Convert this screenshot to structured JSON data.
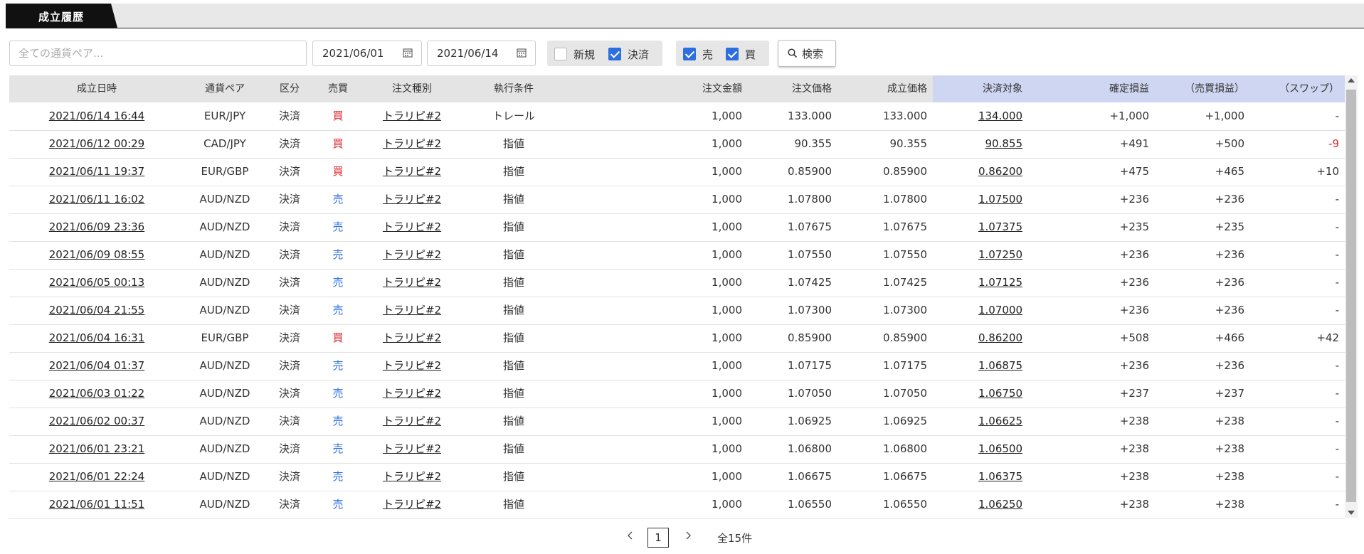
{
  "tab": {
    "label": "成立履歴"
  },
  "filters": {
    "search_placeholder": "全ての通貨ペア...",
    "date_from": "2021/06/01",
    "date_to": "2021/06/14",
    "kubun": [
      {
        "label": "新規",
        "checked": false
      },
      {
        "label": "決済",
        "checked": true
      }
    ],
    "baibai": [
      {
        "label": "売",
        "checked": true
      },
      {
        "label": "買",
        "checked": true
      }
    ],
    "search_button": "検索"
  },
  "columns": [
    "成立日時",
    "通貨ペア",
    "区分",
    "売買",
    "注文種別",
    "執行条件",
    "注文金額",
    "注文価格",
    "成立価格",
    "決済対象",
    "確定損益",
    "（売買損益）",
    "（スワップ）"
  ],
  "rows": [
    {
      "datetime": "2021/06/14 16:44",
      "pair": "EUR/JPY",
      "kubun": "決済",
      "side": "買",
      "order_type": "トラリピ#2",
      "condition": "トレール",
      "amount": "1,000",
      "order_price": "133.000",
      "fill_price": "133.000",
      "target": "134.000",
      "pnl": "+1,000",
      "trade_pnl": "+1,000",
      "swap": "-"
    },
    {
      "datetime": "2021/06/12 00:29",
      "pair": "CAD/JPY",
      "kubun": "決済",
      "side": "買",
      "order_type": "トラリピ#2",
      "condition": "指値",
      "amount": "1,000",
      "order_price": "90.355",
      "fill_price": "90.355",
      "target": "90.855",
      "pnl": "+491",
      "trade_pnl": "+500",
      "swap": "-9"
    },
    {
      "datetime": "2021/06/11 19:37",
      "pair": "EUR/GBP",
      "kubun": "決済",
      "side": "買",
      "order_type": "トラリピ#2",
      "condition": "指値",
      "amount": "1,000",
      "order_price": "0.85900",
      "fill_price": "0.85900",
      "target": "0.86200",
      "pnl": "+475",
      "trade_pnl": "+465",
      "swap": "+10"
    },
    {
      "datetime": "2021/06/11 16:02",
      "pair": "AUD/NZD",
      "kubun": "決済",
      "side": "売",
      "order_type": "トラリピ#2",
      "condition": "指値",
      "amount": "1,000",
      "order_price": "1.07800",
      "fill_price": "1.07800",
      "target": "1.07500",
      "pnl": "+236",
      "trade_pnl": "+236",
      "swap": "-"
    },
    {
      "datetime": "2021/06/09 23:36",
      "pair": "AUD/NZD",
      "kubun": "決済",
      "side": "売",
      "order_type": "トラリピ#2",
      "condition": "指値",
      "amount": "1,000",
      "order_price": "1.07675",
      "fill_price": "1.07675",
      "target": "1.07375",
      "pnl": "+235",
      "trade_pnl": "+235",
      "swap": "-"
    },
    {
      "datetime": "2021/06/09 08:55",
      "pair": "AUD/NZD",
      "kubun": "決済",
      "side": "売",
      "order_type": "トラリピ#2",
      "condition": "指値",
      "amount": "1,000",
      "order_price": "1.07550",
      "fill_price": "1.07550",
      "target": "1.07250",
      "pnl": "+236",
      "trade_pnl": "+236",
      "swap": "-"
    },
    {
      "datetime": "2021/06/05 00:13",
      "pair": "AUD/NZD",
      "kubun": "決済",
      "side": "売",
      "order_type": "トラリピ#2",
      "condition": "指値",
      "amount": "1,000",
      "order_price": "1.07425",
      "fill_price": "1.07425",
      "target": "1.07125",
      "pnl": "+236",
      "trade_pnl": "+236",
      "swap": "-"
    },
    {
      "datetime": "2021/06/04 21:55",
      "pair": "AUD/NZD",
      "kubun": "決済",
      "side": "売",
      "order_type": "トラリピ#2",
      "condition": "指値",
      "amount": "1,000",
      "order_price": "1.07300",
      "fill_price": "1.07300",
      "target": "1.07000",
      "pnl": "+236",
      "trade_pnl": "+236",
      "swap": "-"
    },
    {
      "datetime": "2021/06/04 16:31",
      "pair": "EUR/GBP",
      "kubun": "決済",
      "side": "買",
      "order_type": "トラリピ#2",
      "condition": "指値",
      "amount": "1,000",
      "order_price": "0.85900",
      "fill_price": "0.85900",
      "target": "0.86200",
      "pnl": "+508",
      "trade_pnl": "+466",
      "swap": "+42"
    },
    {
      "datetime": "2021/06/04 01:37",
      "pair": "AUD/NZD",
      "kubun": "決済",
      "side": "売",
      "order_type": "トラリピ#2",
      "condition": "指値",
      "amount": "1,000",
      "order_price": "1.07175",
      "fill_price": "1.07175",
      "target": "1.06875",
      "pnl": "+236",
      "trade_pnl": "+236",
      "swap": "-"
    },
    {
      "datetime": "2021/06/03 01:22",
      "pair": "AUD/NZD",
      "kubun": "決済",
      "side": "売",
      "order_type": "トラリピ#2",
      "condition": "指値",
      "amount": "1,000",
      "order_price": "1.07050",
      "fill_price": "1.07050",
      "target": "1.06750",
      "pnl": "+237",
      "trade_pnl": "+237",
      "swap": "-"
    },
    {
      "datetime": "2021/06/02 00:37",
      "pair": "AUD/NZD",
      "kubun": "決済",
      "side": "売",
      "order_type": "トラリピ#2",
      "condition": "指値",
      "amount": "1,000",
      "order_price": "1.06925",
      "fill_price": "1.06925",
      "target": "1.06625",
      "pnl": "+238",
      "trade_pnl": "+238",
      "swap": "-"
    },
    {
      "datetime": "2021/06/01 23:21",
      "pair": "AUD/NZD",
      "kubun": "決済",
      "side": "売",
      "order_type": "トラリピ#2",
      "condition": "指値",
      "amount": "1,000",
      "order_price": "1.06800",
      "fill_price": "1.06800",
      "target": "1.06500",
      "pnl": "+238",
      "trade_pnl": "+238",
      "swap": "-"
    },
    {
      "datetime": "2021/06/01 22:24",
      "pair": "AUD/NZD",
      "kubun": "決済",
      "side": "売",
      "order_type": "トラリピ#2",
      "condition": "指値",
      "amount": "1,000",
      "order_price": "1.06675",
      "fill_price": "1.06675",
      "target": "1.06375",
      "pnl": "+238",
      "trade_pnl": "+238",
      "swap": "-"
    },
    {
      "datetime": "2021/06/01 11:51",
      "pair": "AUD/NZD",
      "kubun": "決済",
      "side": "売",
      "order_type": "トラリピ#2",
      "condition": "指値",
      "amount": "1,000",
      "order_price": "1.06550",
      "fill_price": "1.06550",
      "target": "1.06250",
      "pnl": "+238",
      "trade_pnl": "+238",
      "swap": "-"
    }
  ],
  "pagination": {
    "current_page": "1",
    "total": "全15件"
  },
  "colors": {
    "buy": "#d9262c",
    "sell": "#2d6fe0",
    "highlight_header": "#cfd6f2",
    "check": "#2d6fe0"
  }
}
